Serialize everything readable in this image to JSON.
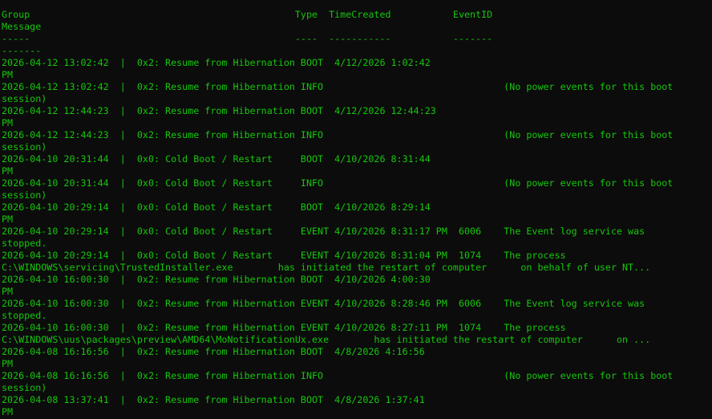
{
  "terminal": {
    "text_color": "#16c60c",
    "background_color": "#0c0c0c",
    "lines": [
      "Group                                               Type  TimeCreated           EventID",
      "Message",
      "-----                                               ----  -----------           -------",
      "-------",
      "2026-04-12 13:02:42  |  0x2: Resume from Hibernation BOOT  4/12/2026 1:02:42",
      "PM",
      "2026-04-12 13:02:42  |  0x2: Resume from Hibernation INFO                                (No power events for this boot",
      "session)",
      "2026-04-12 12:44:23  |  0x2: Resume from Hibernation BOOT  4/12/2026 12:44:23",
      "PM",
      "2026-04-12 12:44:23  |  0x2: Resume from Hibernation INFO                                (No power events for this boot",
      "session)",
      "2026-04-10 20:31:44  |  0x0: Cold Boot / Restart     BOOT  4/10/2026 8:31:44",
      "PM",
      "2026-04-10 20:31:44  |  0x0: Cold Boot / Restart     INFO                                (No power events for this boot",
      "session)",
      "2026-04-10 20:29:14  |  0x0: Cold Boot / Restart     BOOT  4/10/2026 8:29:14",
      "PM",
      "2026-04-10 20:29:14  |  0x0: Cold Boot / Restart     EVENT 4/10/2026 8:31:17 PM  6006    The Event log service was",
      "stopped.",
      "2026-04-10 20:29:14  |  0x0: Cold Boot / Restart     EVENT 4/10/2026 8:31:04 PM  1074    The process",
      "C:\\WINDOWS\\servicing\\TrustedInstaller.exe        has initiated the restart of computer      on behalf of user NT...",
      "2026-04-10 16:00:30  |  0x2: Resume from Hibernation BOOT  4/10/2026 4:00:30",
      "PM",
      "2026-04-10 16:00:30  |  0x2: Resume from Hibernation EVENT 4/10/2026 8:28:46 PM  6006    The Event log service was",
      "stopped.",
      "2026-04-10 16:00:30  |  0x2: Resume from Hibernation EVENT 4/10/2026 8:27:11 PM  1074    The process",
      "C:\\WINDOWS\\uus\\packages\\preview\\AMD64\\MoNotificationUx.exe        has initiated the restart of computer      on ...",
      "2026-04-08 16:16:56  |  0x2: Resume from Hibernation BOOT  4/8/2026 4:16:56",
      "PM",
      "2026-04-08 16:16:56  |  0x2: Resume from Hibernation INFO                                (No power events for this boot",
      "session)",
      "2026-04-08 13:37:41  |  0x2: Resume from Hibernation BOOT  4/8/2026 1:37:41",
      "PM"
    ]
  }
}
